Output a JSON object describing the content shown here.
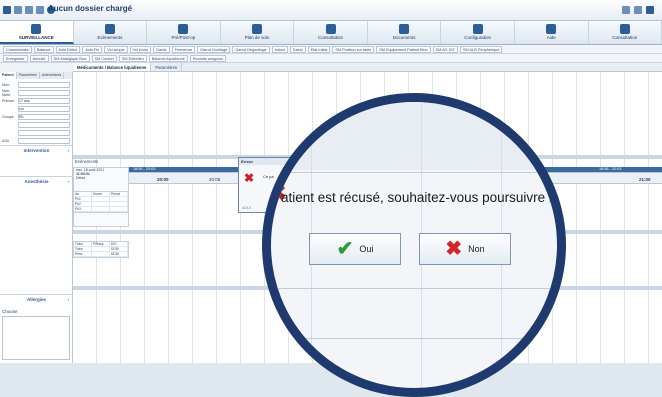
{
  "window": {
    "title": "Aucun dossier chargé"
  },
  "menu": [
    {
      "label": "SURVEILLANCE",
      "icon": "monitor-icon",
      "active": true
    },
    {
      "label": "Evènements",
      "icon": "calendar-icon"
    },
    {
      "label": "Pré/Post-op",
      "icon": "syringe-icon"
    },
    {
      "label": "Plan de soin",
      "icon": "book-icon"
    },
    {
      "label": "Consultation",
      "icon": "clipboard-icon"
    },
    {
      "label": "Documents",
      "icon": "folder-icon"
    },
    {
      "label": "Configuration",
      "icon": "wrench-icon"
    },
    {
      "label": "Aide",
      "icon": "help-icon"
    },
    {
      "label": "Consultation",
      "icon": "user-icon"
    }
  ],
  "toolbar1": [
    "Commentaire",
    "Balance",
    "Acte Début",
    "Acte Fin",
    "Vol simple",
    "Vol évolu",
    "Garde",
    "Fermeture",
    "Garrot Gonflage",
    "Garrot Dégonflage",
    "Induct",
    "Extub",
    "Etat Initial",
    "SM Position sur table",
    "SM Equipement Patient Bloc",
    "SM AG IOT",
    "SM ALR Périphérique"
  ],
  "toolbar2": [
    "Enregistrer",
    "Annuler",
    "SM Antalgique Bloc",
    "SM Confort",
    "SM Entretien",
    "Balance liquidienne",
    "Produits sanguins"
  ],
  "subtabs": [
    "Médicaments / Balance liquidienne",
    "Paramètres"
  ],
  "left_tabs": [
    "Patient",
    "Paramètres",
    "Antécédents"
  ],
  "left_fields": [
    {
      "label": "Nom"
    },
    {
      "label": "Nom Marit."
    },
    {
      "label": "Prénom",
      "value": "17 ans"
    },
    {
      "label": "",
      "value": "cm"
    },
    {
      "label": "Groupe",
      "value": "Rh"
    },
    {
      "label": ""
    },
    {
      "label": ""
    },
    {
      "label": "ASA"
    }
  ],
  "left_sections": [
    "Intervention",
    "Anesthésie",
    "Allergies"
  ],
  "choose_label": "Choose",
  "events_label": "Evènements",
  "patient_info": [
    "mer. 18 août 2021",
    "11:03:01",
    "Début"
  ],
  "mini_table1": [
    [
      "Arr",
      "Durée",
      "Prescr"
    ],
    [
      "Ph1",
      "",
      ""
    ],
    [
      "Ph2",
      "",
      ""
    ],
    [
      "Ph3",
      "",
      ""
    ]
  ],
  "mini_table2": [
    [
      "Tritra",
      "PiRasp",
      "DIO"
    ],
    [
      "Tritra",
      "",
      "DDDi"
    ],
    [
      "Plmo",
      "",
      "DDDi"
    ]
  ],
  "timehead": {
    "left": "18:58 - 20:03",
    "right": "18:58 - 22:03"
  },
  "time_ticks": [
    "20:00",
    "20:05",
    "20:10",
    "21:00"
  ],
  "small_dialog": {
    "title": "Erreur",
    "text": "Ce pa",
    "version": "v2.0.0"
  },
  "dialog": {
    "message": "atient est récusé, souhaitez-vous poursuivre l",
    "yes_label": "Oui",
    "no_label": "Non"
  },
  "colors": {
    "accent": "#2b5d96",
    "magnifier_ring": "#1f3a6e",
    "check": "#2e9a3a",
    "cross": "#d0262c"
  }
}
